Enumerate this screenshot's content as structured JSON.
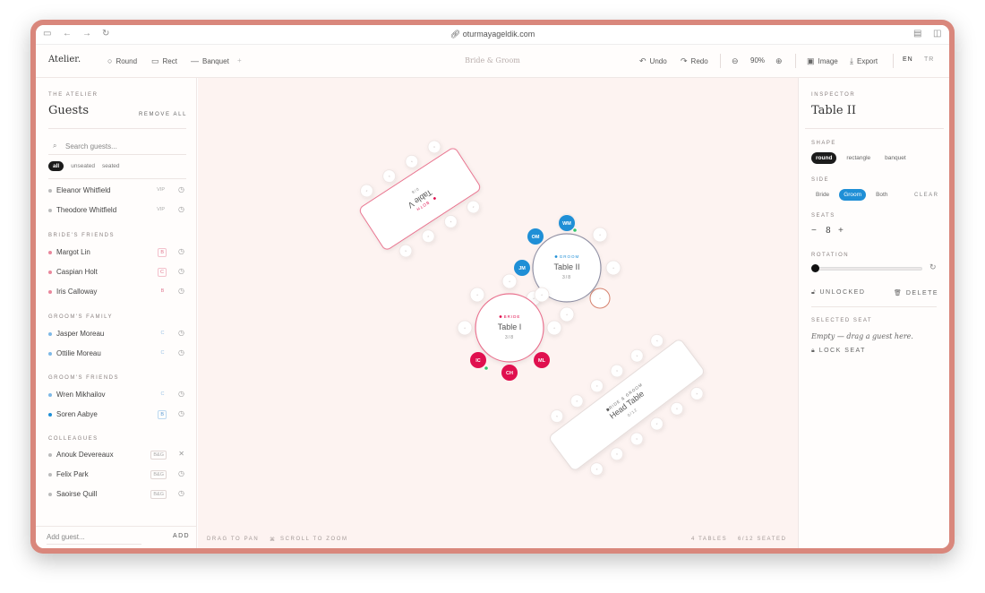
{
  "browser": {
    "url": "oturmayageldik.com"
  },
  "app": {
    "logo": "Atelier.",
    "doc_title": "Bride & Groom",
    "tools": {
      "round": "Round",
      "rect": "Rect",
      "banquet": "Banquet",
      "more": "+"
    },
    "actions": {
      "undo": "Undo",
      "redo": "Redo",
      "zoom": "90%",
      "image": "Image",
      "export": "Export"
    },
    "lang": {
      "en": "EN",
      "tr": "TR"
    }
  },
  "sidebar": {
    "eyebrow": "THE ATELIER",
    "title": "Guests",
    "remove_all": "REMOVE ALL",
    "search_placeholder": "Search guests...",
    "filters": [
      "all",
      "unseated",
      "seated"
    ],
    "groups": [
      {
        "label": "",
        "guests": [
          {
            "name": "Eleanor Whitfield",
            "tag": "VIP"
          },
          {
            "name": "Theodore Whitfield",
            "tag": "VIP"
          }
        ]
      },
      {
        "label": "BRIDE'S FRIENDS",
        "guests": [
          {
            "name": "Margot Lin",
            "tag": "B"
          },
          {
            "name": "Caspian Holt",
            "tag": "C"
          },
          {
            "name": "Iris Calloway",
            "tag": "B"
          }
        ]
      },
      {
        "label": "GROOM'S FAMILY",
        "guests": [
          {
            "name": "Jasper Moreau",
            "tag": "C"
          },
          {
            "name": "Ottilie Moreau",
            "tag": "C"
          }
        ]
      },
      {
        "label": "GROOM'S FRIENDS",
        "guests": [
          {
            "name": "Wren Mikhailov",
            "tag": "C"
          },
          {
            "name": "Soren Aabye",
            "tag": "B"
          }
        ]
      },
      {
        "label": "COLLEAGUES",
        "guests": [
          {
            "name": "Anouk Devereaux",
            "tag": "B&G"
          },
          {
            "name": "Felix Park",
            "tag": "B&G"
          },
          {
            "name": "Saoirse Quill",
            "tag": "B&G"
          }
        ]
      }
    ],
    "add_placeholder": "Add guest...",
    "add_label": "ADD"
  },
  "canvas": {
    "tables": [
      {
        "name": "Table V",
        "side": "BOTH",
        "count": "0/8"
      },
      {
        "name": "Table II",
        "side": "GROOM",
        "count": "3/8"
      },
      {
        "name": "Table I",
        "side": "BRIDE",
        "count": "3/8"
      },
      {
        "name": "Head Table",
        "side": "BRIDE & GROOM",
        "count": "0/12"
      }
    ],
    "seat_initials": {
      "wm": "WM",
      "om": "OM",
      "jm": "JM",
      "ic": "IC",
      "ch": "CH",
      "ml": "ML"
    },
    "hints": {
      "pan": "DRAG TO PAN",
      "zoom": "SCROLL TO ZOOM"
    },
    "status": {
      "tables": "4 TABLES",
      "seated": "6/12 SEATED"
    }
  },
  "inspector": {
    "eyebrow": "INSPECTOR",
    "title": "Table II",
    "shape_label": "SHAPE",
    "shapes": [
      "round",
      "rectangle",
      "banquet"
    ],
    "side_label": "SIDE",
    "sides": [
      "Bride",
      "Groom",
      "Both"
    ],
    "clear": "CLEAR",
    "seats_label": "SEATS",
    "seats_value": "8",
    "minus": "−",
    "plus": "+",
    "rotation_label": "ROTATION",
    "rotation_value": 0,
    "unlocked": "UNLOCKED",
    "delete": "DELETE",
    "selected_seat_label": "SELECTED SEAT",
    "selected_seat_empty": "Empty — drag a guest here.",
    "lock_seat": "LOCK SEAT"
  },
  "colors": {
    "bride": "#e0104f",
    "groom": "#1f8fd6",
    "accent": "#d9877c"
  }
}
